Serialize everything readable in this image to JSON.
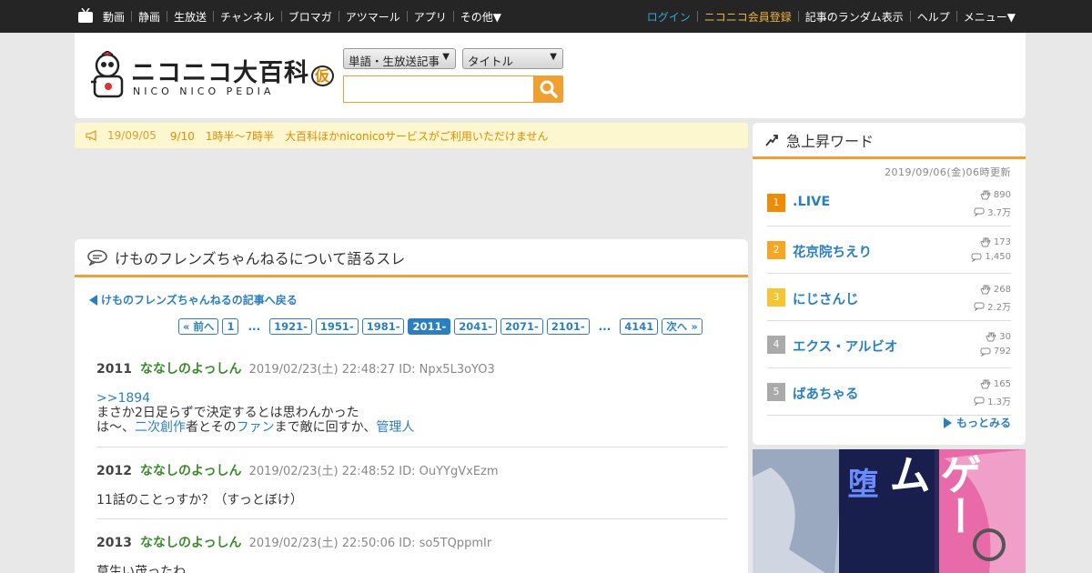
{
  "topnav": {
    "left": [
      "動画",
      "静画",
      "生放送",
      "チャンネル",
      "ブロマガ",
      "アツマール",
      "アプリ",
      "その他▼"
    ],
    "login": "ログイン",
    "register": "ニコニコ会員登録",
    "right": [
      "記事のランダム表示",
      "ヘルプ",
      "メニュー▼"
    ]
  },
  "header": {
    "logo_title": "ニコニコ大百科",
    "logo_badge": "仮",
    "logo_sub": "NICO NICO PEDIA",
    "select_category": "単語・生放送記事",
    "select_field": "タイトル",
    "search_value": ""
  },
  "notice": {
    "date": "19/09/05",
    "text": "9/10　1時半～7時半　大百科ほかniconicoサービスがご利用いただけません"
  },
  "thread": {
    "title": "けものフレンズちゃんねるについて語るスレ",
    "back_link": "けものフレンズちゃんねるの記事へ戻る",
    "pager": [
      "« 前へ",
      "1",
      "...",
      "1921-",
      "1951-",
      "1981-",
      "2011-",
      "2041-",
      "2071-",
      "2101-",
      "...",
      "4141",
      "次へ »"
    ],
    "pager_current": "2011-",
    "posts": [
      {
        "num": "2011",
        "name": "ななしのよっしん",
        "meta": "2019/02/23(土) 22:48:27 ID: Npx5L3oYO3",
        "line1_link": ">>1894",
        "line2": "まさか2日足らずで決定するとは思わんかった",
        "line3_a": "は～、",
        "line3_link1": "二次創作",
        "line3_b": "者とその",
        "line3_link2": "ファン",
        "line3_c": "まで敵に回すか、",
        "line3_link3": "管理人"
      },
      {
        "num": "2012",
        "name": "ななしのよっしん",
        "meta": "2019/02/23(土) 22:48:52 ID: OuYYgVxEzm",
        "line1": "11話のことっすか？（すっとぼけ）"
      },
      {
        "num": "2013",
        "name": "ななしのよっしん",
        "meta": "2019/02/23(土) 22:50:06 ID: so5TQppmIr",
        "line1": "草生い茂ったわ"
      }
    ]
  },
  "sidebar": {
    "title": "急上昇ワード",
    "updated": "2019/09/06(金)06時更新",
    "ranks": [
      {
        "rank": "1",
        "word": ".LIVE",
        "stat1": "890",
        "stat2": "3.7万",
        "color": "#f08a00"
      },
      {
        "rank": "2",
        "word": "花京院ちえり",
        "stat1": "173",
        "stat2": "1,450",
        "color": "#f5a623"
      },
      {
        "rank": "3",
        "word": "にじさんじ",
        "stat1": "268",
        "stat2": "2.2万",
        "color": "#f7c531"
      },
      {
        "rank": "4",
        "word": "エクス・アルビオ",
        "stat1": "30",
        "stat2": "792",
        "color": "#aaaaaa"
      },
      {
        "rank": "5",
        "word": "ばあちゃる",
        "stat1": "165",
        "stat2": "1.3万",
        "color": "#aaaaaa"
      }
    ],
    "more": "もっとみる"
  },
  "ad": {
    "text": "ゲーム",
    "text2": "堕"
  }
}
